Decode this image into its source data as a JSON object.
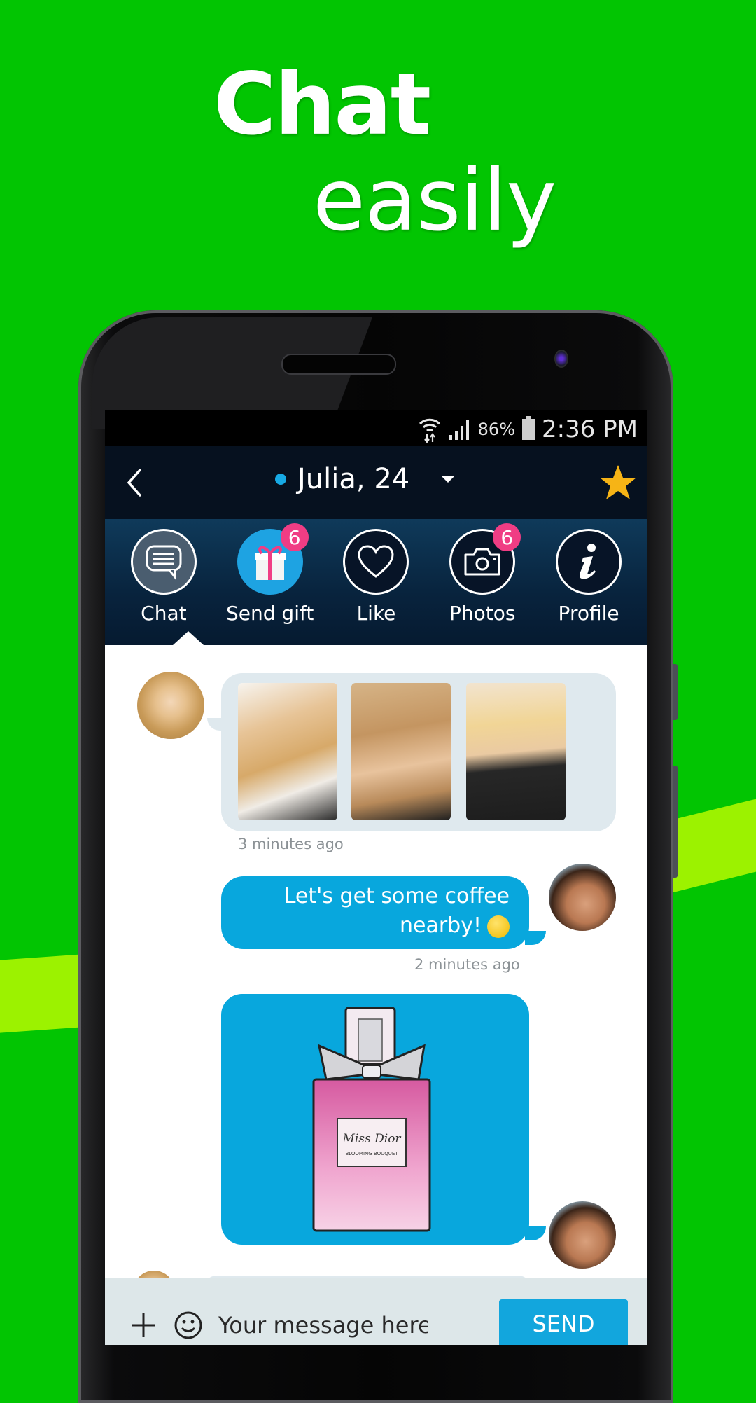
{
  "promo": {
    "headline_bold": "Chat",
    "headline_light": "easily",
    "colors": {
      "background": "#02c502",
      "stripe": "#9cf200"
    }
  },
  "status_bar": {
    "icons": [
      "wifi-icon",
      "signal-icon",
      "battery-icon"
    ],
    "battery_percent": "86%",
    "time": "2:36 PM"
  },
  "header": {
    "back_icon": "chevron-left-icon",
    "contact_name": "Julia, 24",
    "online": true,
    "dropdown_icon": "caret-down-icon",
    "favorite_icon": "star-icon",
    "colors": {
      "online_dot": "#17aae5",
      "star": "#f6b416"
    }
  },
  "tabs": [
    {
      "label": "Chat",
      "icon": "chat-bubble-icon",
      "active": true,
      "badge": null
    },
    {
      "label": "Send gift",
      "icon": "gift-icon",
      "active": false,
      "badge": "6"
    },
    {
      "label": "Like",
      "icon": "heart-icon",
      "active": false,
      "badge": null
    },
    {
      "label": "Photos",
      "icon": "camera-icon",
      "active": false,
      "badge": "6"
    },
    {
      "label": "Profile",
      "icon": "info-icon",
      "active": false,
      "badge": null
    }
  ],
  "messages": [
    {
      "direction": "incoming",
      "type": "photos",
      "photo_count": 3,
      "timestamp": "3 minutes ago"
    },
    {
      "direction": "outgoing",
      "type": "text",
      "text_line1": "Let's get some coffee",
      "text_line2": "nearby!",
      "emoji": "winking-face",
      "timestamp": "2 minutes ago"
    },
    {
      "direction": "outgoing",
      "type": "gift",
      "gift_label": "Miss Dior",
      "gift_sublabel": "BLOOMING BOUQUET"
    }
  ],
  "composer": {
    "placeholder": "Your message here",
    "value": "",
    "send_label": "SEND",
    "colors": {
      "send": "#12a6dd",
      "bubble_out": "#08a7dd",
      "bubble_in": "#dfe9ee"
    }
  }
}
